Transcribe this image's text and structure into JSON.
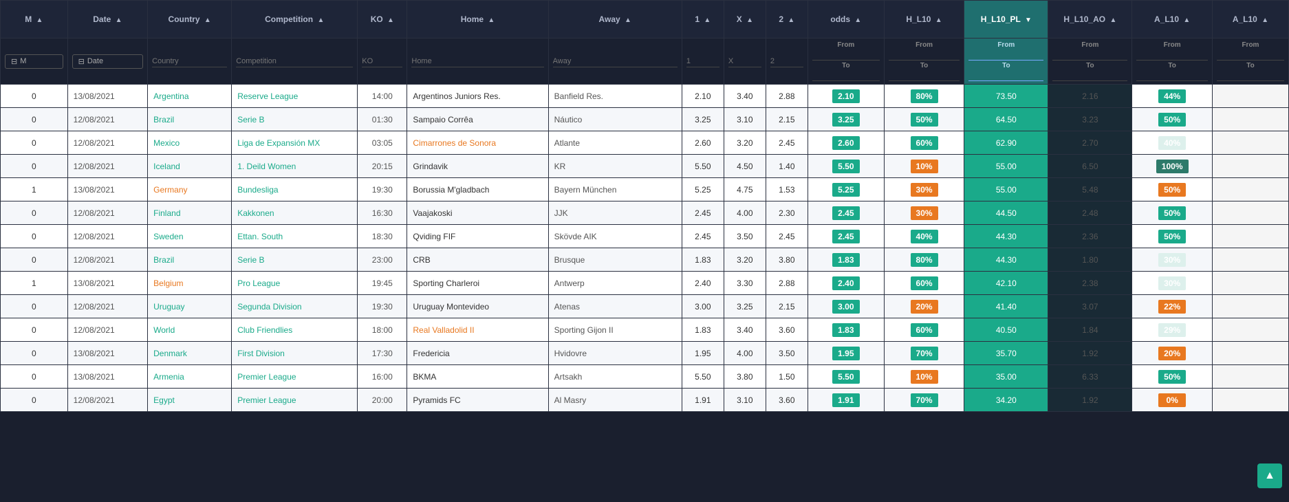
{
  "columns": {
    "m": "M",
    "date": "Date",
    "country": "Country",
    "competition": "Competition",
    "ko": "KO",
    "home": "Home",
    "away": "Away",
    "one": "1",
    "x": "X",
    "two": "2",
    "odds": "odds",
    "hl10": "H_L10",
    "hl10pl": "H_L10_PL",
    "hl10ao": "H_L10_AO",
    "al10": "A_L10",
    "al10last": "A_L10"
  },
  "filter_labels": {
    "m": "M",
    "date": "Date",
    "country": "Country",
    "competition": "Competition",
    "ko": "KO",
    "home": "Home",
    "away": "Away",
    "one": "1",
    "x": "X",
    "two": "2",
    "from": "From",
    "to": "To"
  },
  "rows": [
    {
      "m": "0",
      "date": "13/08/2021",
      "country": "Argentina",
      "competition": "Reserve League",
      "ko": "14:00",
      "home": "Argentinos Juniors Res.",
      "away": "Banfield Res.",
      "one": "2.10",
      "x": "3.40",
      "two": "2.88",
      "odds": "2.10",
      "odds_color": "#1aaa8a",
      "hl10_pct": "80%",
      "hl10_color": "#1aaa8a",
      "hl10ao": "73.50",
      "hl10ao_color": "#1aaa8a",
      "al10": "2.16",
      "al10_color": "#e0f5f0",
      "al10_pct": "44%",
      "al10_pct_color": "#1aaa8a"
    },
    {
      "m": "0",
      "date": "12/08/2021",
      "country": "Brazil",
      "competition": "Serie B",
      "ko": "01:30",
      "home": "Sampaio Corrêa",
      "away": "Náutico",
      "one": "3.25",
      "x": "3.10",
      "two": "2.15",
      "odds": "3.25",
      "odds_color": "#1aaa8a",
      "hl10_pct": "50%",
      "hl10_color": "#1aaa8a",
      "hl10ao": "64.50",
      "hl10ao_color": "#1aaa8a",
      "al10": "3.23",
      "al10_color": "#e0f5f0",
      "al10_pct": "50%",
      "al10_pct_color": "#1aaa8a"
    },
    {
      "m": "0",
      "date": "12/08/2021",
      "country": "Mexico",
      "competition": "Liga de Expansión MX",
      "ko": "03:05",
      "home": "Cimarrones de Sonora",
      "away": "Atlante",
      "one": "2.60",
      "x": "3.20",
      "two": "2.45",
      "odds": "2.60",
      "odds_color": "#1aaa8a",
      "hl10_pct": "60%",
      "hl10_color": "#1aaa8a",
      "hl10ao": "62.90",
      "hl10ao_color": "#1aaa8a",
      "al10": "2.70",
      "al10_color": "#e0f5f0",
      "al10_pct": "40%",
      "al10_pct_color": "#ddf0ec"
    },
    {
      "m": "0",
      "date": "12/08/2021",
      "country": "Iceland",
      "competition": "1. Deild Women",
      "ko": "20:15",
      "home": "Grindavik",
      "away": "KR",
      "one": "5.50",
      "x": "4.50",
      "two": "1.40",
      "odds": "5.50",
      "odds_color": "#1aaa8a",
      "hl10_pct": "10%",
      "hl10_color": "#e87820",
      "hl10ao": "55.00",
      "hl10ao_color": "#1aaa8a",
      "al10": "6.50",
      "al10_color": "#e0f5f0",
      "al10_pct": "100%",
      "al10_pct_color": "#2d7a6a"
    },
    {
      "m": "1",
      "date": "13/08/2021",
      "country": "Germany",
      "competition": "Bundesliga",
      "ko": "19:30",
      "home": "Borussia M'gladbach",
      "away": "Bayern München",
      "one": "5.25",
      "x": "4.75",
      "two": "1.53",
      "odds": "5.25",
      "odds_color": "#1aaa8a",
      "hl10_pct": "30%",
      "hl10_color": "#e87820",
      "hl10ao": "55.00",
      "hl10ao_color": "#1aaa8a",
      "al10": "5.48",
      "al10_color": "#e0f5f0",
      "al10_pct": "50%",
      "al10_pct_color": "#e87820"
    },
    {
      "m": "0",
      "date": "12/08/2021",
      "country": "Finland",
      "competition": "Kakkonen",
      "ko": "16:30",
      "home": "Vaajakoski",
      "away": "JJK",
      "one": "2.45",
      "x": "4.00",
      "two": "2.30",
      "odds": "2.45",
      "odds_color": "#1aaa8a",
      "hl10_pct": "30%",
      "hl10_color": "#e87820",
      "hl10ao": "44.50",
      "hl10ao_color": "#1aaa8a",
      "al10": "2.48",
      "al10_color": "#e0f5f0",
      "al10_pct": "50%",
      "al10_pct_color": "#1aaa8a"
    },
    {
      "m": "0",
      "date": "12/08/2021",
      "country": "Sweden",
      "competition": "Ettan. South",
      "ko": "18:30",
      "home": "Qviding FIF",
      "away": "Skövde AIK",
      "one": "2.45",
      "x": "3.50",
      "two": "2.45",
      "odds": "2.45",
      "odds_color": "#1aaa8a",
      "hl10_pct": "40%",
      "hl10_color": "#1aaa8a",
      "hl10ao": "44.30",
      "hl10ao_color": "#1aaa8a",
      "al10": "2.36",
      "al10_color": "#e0f5f0",
      "al10_pct": "50%",
      "al10_pct_color": "#1aaa8a"
    },
    {
      "m": "0",
      "date": "12/08/2021",
      "country": "Brazil",
      "competition": "Serie B",
      "ko": "23:00",
      "home": "CRB",
      "away": "Brusque",
      "one": "1.83",
      "x": "3.20",
      "two": "3.80",
      "odds": "1.83",
      "odds_color": "#1aaa8a",
      "hl10_pct": "80%",
      "hl10_color": "#1aaa8a",
      "hl10ao": "44.30",
      "hl10ao_color": "#1aaa8a",
      "al10": "1.80",
      "al10_color": "#e0f5f0",
      "al10_pct": "30%",
      "al10_pct_color": "#ddf0ec"
    },
    {
      "m": "1",
      "date": "13/08/2021",
      "country": "Belgium",
      "competition": "Pro League",
      "ko": "19:45",
      "home": "Sporting Charleroi",
      "away": "Antwerp",
      "one": "2.40",
      "x": "3.30",
      "two": "2.88",
      "odds": "2.40",
      "odds_color": "#1aaa8a",
      "hl10_pct": "60%",
      "hl10_color": "#1aaa8a",
      "hl10ao": "42.10",
      "hl10ao_color": "#1aaa8a",
      "al10": "2.38",
      "al10_color": "#e0f5f0",
      "al10_pct": "30%",
      "al10_pct_color": "#ddf0ec"
    },
    {
      "m": "0",
      "date": "12/08/2021",
      "country": "Uruguay",
      "competition": "Segunda Division",
      "ko": "19:30",
      "home": "Uruguay Montevideo",
      "away": "Atenas",
      "one": "3.00",
      "x": "3.25",
      "two": "2.15",
      "odds": "3.00",
      "odds_color": "#1aaa8a",
      "hl10_pct": "20%",
      "hl10_color": "#e87820",
      "hl10ao": "41.40",
      "hl10ao_color": "#1aaa8a",
      "al10": "3.07",
      "al10_color": "#e0f5f0",
      "al10_pct": "22%",
      "al10_pct_color": "#e87820"
    },
    {
      "m": "0",
      "date": "12/08/2021",
      "country": "World",
      "competition": "Club Friendlies",
      "ko": "18:00",
      "home": "Real Valladolid II",
      "away": "Sporting Gijon II",
      "one": "1.83",
      "x": "3.40",
      "two": "3.60",
      "odds": "1.83",
      "odds_color": "#1aaa8a",
      "hl10_pct": "60%",
      "hl10_color": "#1aaa8a",
      "hl10ao": "40.50",
      "hl10ao_color": "#1aaa8a",
      "al10": "1.84",
      "al10_color": "#e0f5f0",
      "al10_pct": "29%",
      "al10_pct_color": "#ddf0ec"
    },
    {
      "m": "0",
      "date": "13/08/2021",
      "country": "Denmark",
      "competition": "First Division",
      "ko": "17:30",
      "home": "Fredericia",
      "away": "Hvidovre",
      "one": "1.95",
      "x": "4.00",
      "two": "3.50",
      "odds": "1.95",
      "odds_color": "#1aaa8a",
      "hl10_pct": "70%",
      "hl10_color": "#1aaa8a",
      "hl10ao": "35.70",
      "hl10ao_color": "#1aaa8a",
      "al10": "1.92",
      "al10_color": "#e0f5f0",
      "al10_pct": "20%",
      "al10_pct_color": "#e87820"
    },
    {
      "m": "0",
      "date": "13/08/2021",
      "country": "Armenia",
      "competition": "Premier League",
      "ko": "16:00",
      "home": "BKMA",
      "away": "Artsakh",
      "one": "5.50",
      "x": "3.80",
      "two": "1.50",
      "odds": "5.50",
      "odds_color": "#1aaa8a",
      "hl10_pct": "10%",
      "hl10_color": "#e87820",
      "hl10ao": "35.00",
      "hl10ao_color": "#1aaa8a",
      "al10": "6.33",
      "al10_color": "#e0f5f0",
      "al10_pct": "50%",
      "al10_pct_color": "#1aaa8a"
    },
    {
      "m": "0",
      "date": "12/08/2021",
      "country": "Egypt",
      "competition": "Premier League",
      "ko": "20:00",
      "home": "Pyramids FC",
      "away": "Al Masry",
      "one": "1.91",
      "x": "3.10",
      "two": "3.60",
      "odds": "1.91",
      "odds_color": "#1aaa8a",
      "hl10_pct": "70%",
      "hl10_color": "#1aaa8a",
      "hl10ao": "34.20",
      "hl10ao_color": "#1aaa8a",
      "al10": "1.92",
      "al10_color": "#e0f5f0",
      "al10_pct": "0%",
      "al10_pct_color": "#e87820"
    }
  ],
  "scroll_top_label": "▲"
}
